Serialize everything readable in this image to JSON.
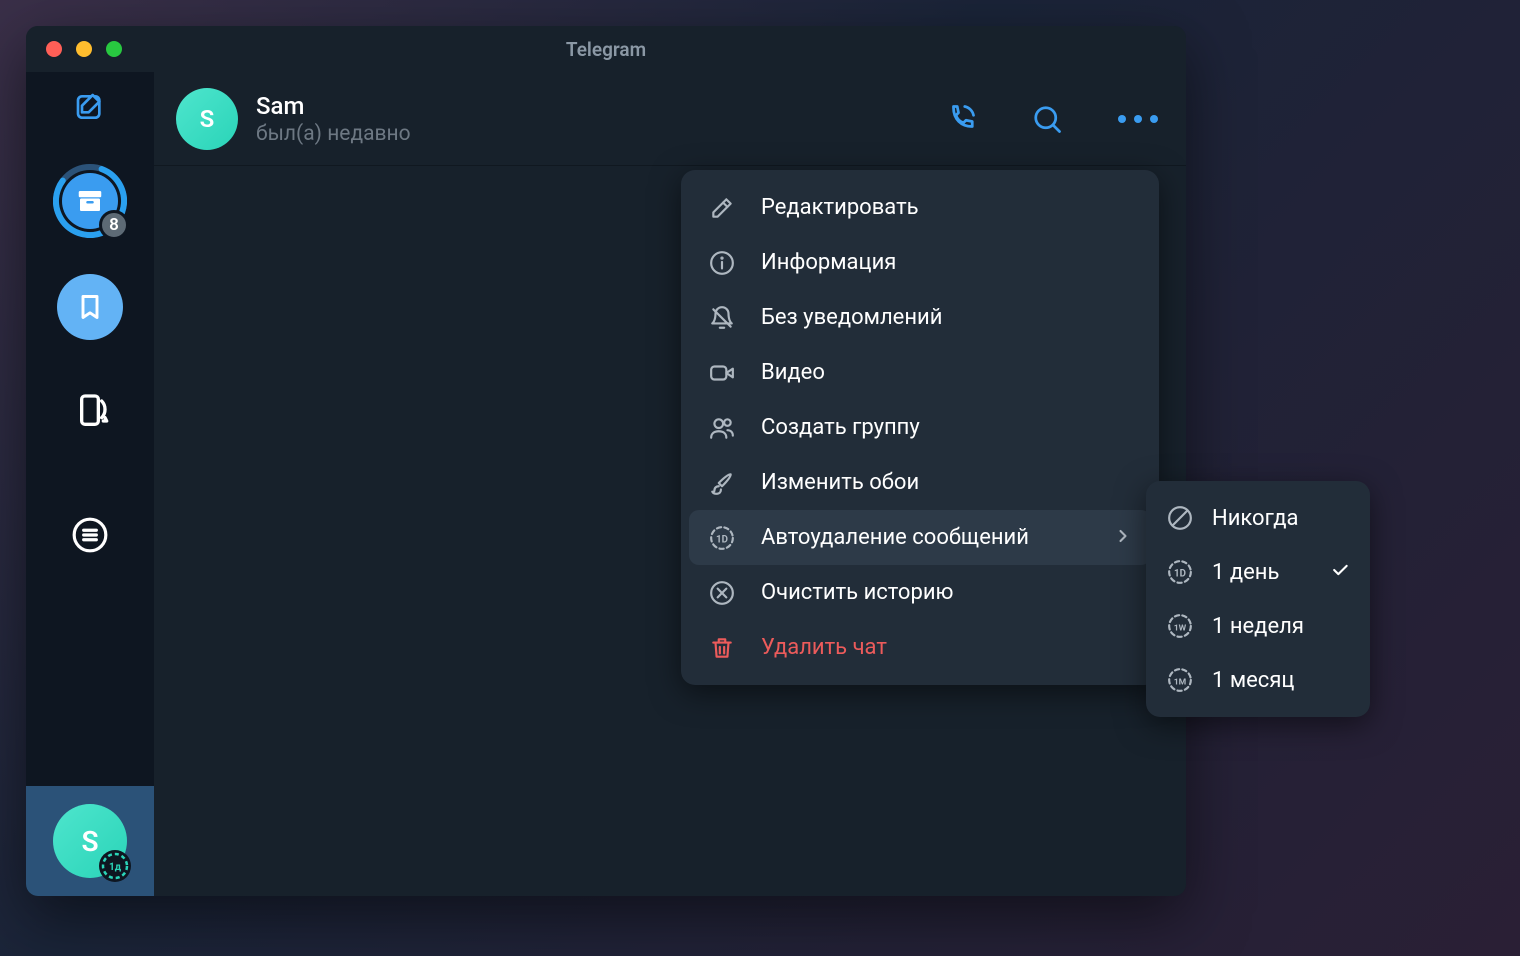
{
  "window": {
    "title": "Telegram"
  },
  "sidebar": {
    "archive_badge": "8",
    "chat_avatar_letter": "S",
    "chat_small_badge": "1д"
  },
  "chat_header": {
    "avatar_letter": "S",
    "name": "Sam",
    "status": "был(а) недавно"
  },
  "menu": {
    "items": [
      {
        "key": "edit",
        "label": "Редактировать"
      },
      {
        "key": "info",
        "label": "Информация"
      },
      {
        "key": "mute",
        "label": "Без уведомлений"
      },
      {
        "key": "video",
        "label": "Видео"
      },
      {
        "key": "group",
        "label": "Создать группу"
      },
      {
        "key": "wallpaper",
        "label": "Изменить обои"
      },
      {
        "key": "autodelete",
        "label": "Автоудаление сообщений"
      },
      {
        "key": "clear",
        "label": "Очистить историю"
      },
      {
        "key": "delete",
        "label": "Удалить чат"
      }
    ]
  },
  "submenu": {
    "items": [
      {
        "key": "never",
        "label": "Никогда",
        "selected": false,
        "badge": ""
      },
      {
        "key": "1d",
        "label": "1 день",
        "selected": true,
        "badge": "1D"
      },
      {
        "key": "1w",
        "label": "1 неделя",
        "selected": false,
        "badge": "1W"
      },
      {
        "key": "1m",
        "label": "1 месяц",
        "selected": false,
        "badge": "1M"
      }
    ]
  }
}
